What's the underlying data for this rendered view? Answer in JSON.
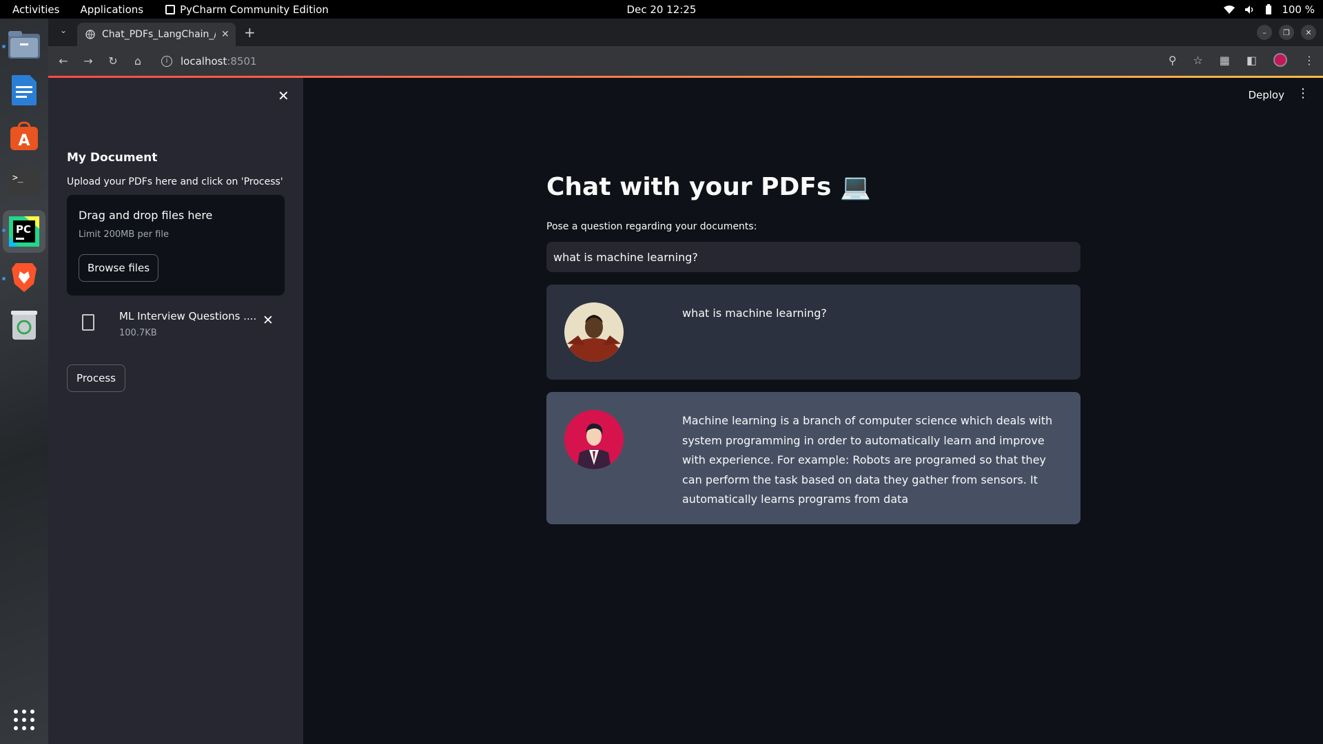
{
  "topbar": {
    "activities": "Activities",
    "applications": "Applications",
    "app_name": "PyCharm Community Edition",
    "clock": "Dec 20  12:25",
    "battery": "100 %"
  },
  "dock": {
    "items": [
      "files-icon",
      "writer-icon",
      "app-center-icon",
      "terminal-icon",
      "pycharm-icon",
      "brave-icon",
      "trash-icon"
    ]
  },
  "browser": {
    "tab_title": "Chat_PDFs_LangChain_/",
    "url_host": "localhost",
    "url_port": ":8501"
  },
  "sidebar": {
    "title": "My Document",
    "upload_label": "Upload your PDFs here and click on 'Process'",
    "dropzone_title": "Drag and drop files here",
    "dropzone_limit": "Limit 200MB per file",
    "browse_label": "Browse files",
    "file": {
      "name": "ML Interview Questions ....",
      "size": "100.7KB"
    },
    "process_label": "Process"
  },
  "header": {
    "deploy_label": "Deploy"
  },
  "main": {
    "title": "Chat with your PDFs 💻",
    "question_label": "Pose a question regarding your documents:",
    "question_value": "what is machine learning?",
    "messages": [
      {
        "role": "user",
        "text": "what is machine learning?"
      },
      {
        "role": "bot",
        "text": "Machine learning is a branch of computer science which deals with system programming in order to automatically learn and improve with experience. For example: Robots are programed so that they can perform the task based on data they gather from sensors. It automatically learns programs from data"
      }
    ]
  },
  "colors": {
    "app_bg": "#0e1117",
    "sidebar_bg": "#262730",
    "user_msg_bg": "#2b313e",
    "bot_msg_bg": "#475063",
    "accent": "#ff4b4b"
  }
}
